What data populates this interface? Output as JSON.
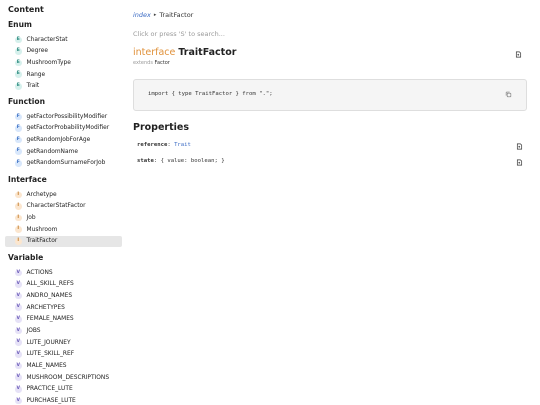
{
  "sidebar": {
    "title": "Content",
    "sections": [
      {
        "title": "Enum",
        "badge": "E",
        "items": [
          "CharacterStat",
          "Degree",
          "MushroomType",
          "Range",
          "Trait"
        ]
      },
      {
        "title": "Function",
        "badge": "F",
        "items": [
          "getFactorPossibilityModifier",
          "getFactorProbabilityModifier",
          "getRandomJobForAge",
          "getRandomName",
          "getRandomSurnameForJob"
        ]
      },
      {
        "title": "Interface",
        "badge": "I",
        "items": [
          "Archetype",
          "CharacterStatFactor",
          "Job",
          "Mushroom",
          "TraitFactor"
        ]
      },
      {
        "title": "Variable",
        "badge": "V",
        "items": [
          "ACTIONS",
          "ALL_SKILL_REFS",
          "ANDRO_NAMES",
          "ARCHETYPES",
          "FEMALE_NAMES",
          "JOBS",
          "LUTE_JOURNEY",
          "LUTE_SKILL_REF",
          "MALE_NAMES",
          "MUSHROOM_DESCRIPTIONS",
          "PRACTICE_LUTE",
          "PURCHASE_LUTE"
        ]
      }
    ],
    "active_item": "TraitFactor"
  },
  "breadcrumb": {
    "link": "index",
    "separator": "▸",
    "current": "TraitFactor"
  },
  "search": {
    "placeholder": "Click or press 'S' to search..."
  },
  "interface": {
    "keyword": "interface",
    "name": "TraitFactor",
    "extends_label": "extends",
    "extends_name": "Factor"
  },
  "import_code": "import { type TraitFactor } from \".\";",
  "properties": {
    "title": "Properties",
    "items": [
      {
        "name": "reference",
        "sep": ": ",
        "type": "Trait"
      },
      {
        "name": "state",
        "sep": ": ",
        "type": "{ value: boolean; }"
      }
    ]
  },
  "icons": {
    "link": "link-icon",
    "copy": "copy-icon"
  },
  "colors": {
    "keyword": "#e0913a",
    "link": "#3b6bc4",
    "active_bg": "#e6e6e6"
  }
}
